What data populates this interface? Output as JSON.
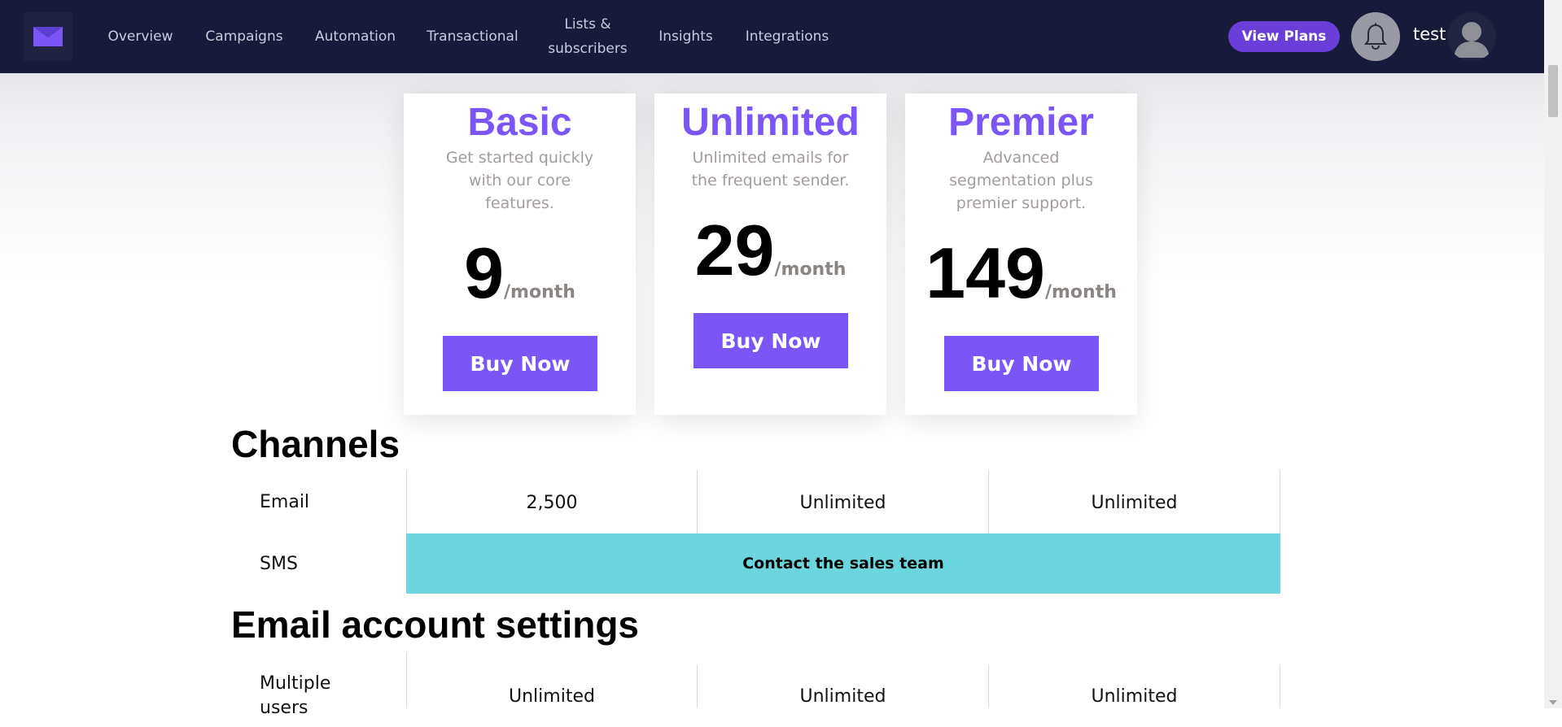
{
  "nav": {
    "items": [
      {
        "label": "Overview"
      },
      {
        "label": "Campaigns"
      },
      {
        "label": "Automation"
      },
      {
        "label": "Transactional"
      },
      {
        "label": "Lists &\nsubscribers"
      },
      {
        "label": "Insights"
      },
      {
        "label": "Integrations"
      }
    ],
    "view_plans_label": "View Plans",
    "username": "test",
    "icons": {
      "logo": "mail-logo-icon",
      "bell": "bell-icon",
      "avatar": "user-avatar-icon"
    }
  },
  "plans": [
    {
      "name": "Basic",
      "description": "Get started quickly with our core features.",
      "price": "9",
      "period": "/month",
      "button": "Buy Now"
    },
    {
      "name": "Unlimited",
      "description": "Unlimited emails for the frequent sender.",
      "price": "29",
      "period": "/month",
      "button": "Buy Now"
    },
    {
      "name": "Premier",
      "description": "Advanced segmentation plus premier support.",
      "price": "149",
      "period": "/month",
      "button": "Buy Now"
    }
  ],
  "sections": {
    "channels": {
      "title": "Channels",
      "rows": [
        {
          "label": "Email",
          "values": [
            "2,500",
            "Unlimited",
            "Unlimited"
          ]
        },
        {
          "label": "SMS",
          "span_value": "Contact the sales team"
        }
      ]
    },
    "email_settings": {
      "title": "Email account settings",
      "rows": [
        {
          "label": "Multiple users",
          "values": [
            "Unlimited",
            "Unlimited",
            "Unlimited"
          ]
        }
      ]
    }
  },
  "colors": {
    "nav_bg": "#171a38",
    "accent": "#7b55f6",
    "view_plans_bg": "#6a3fd9",
    "sms_band": "#6bd6df"
  }
}
